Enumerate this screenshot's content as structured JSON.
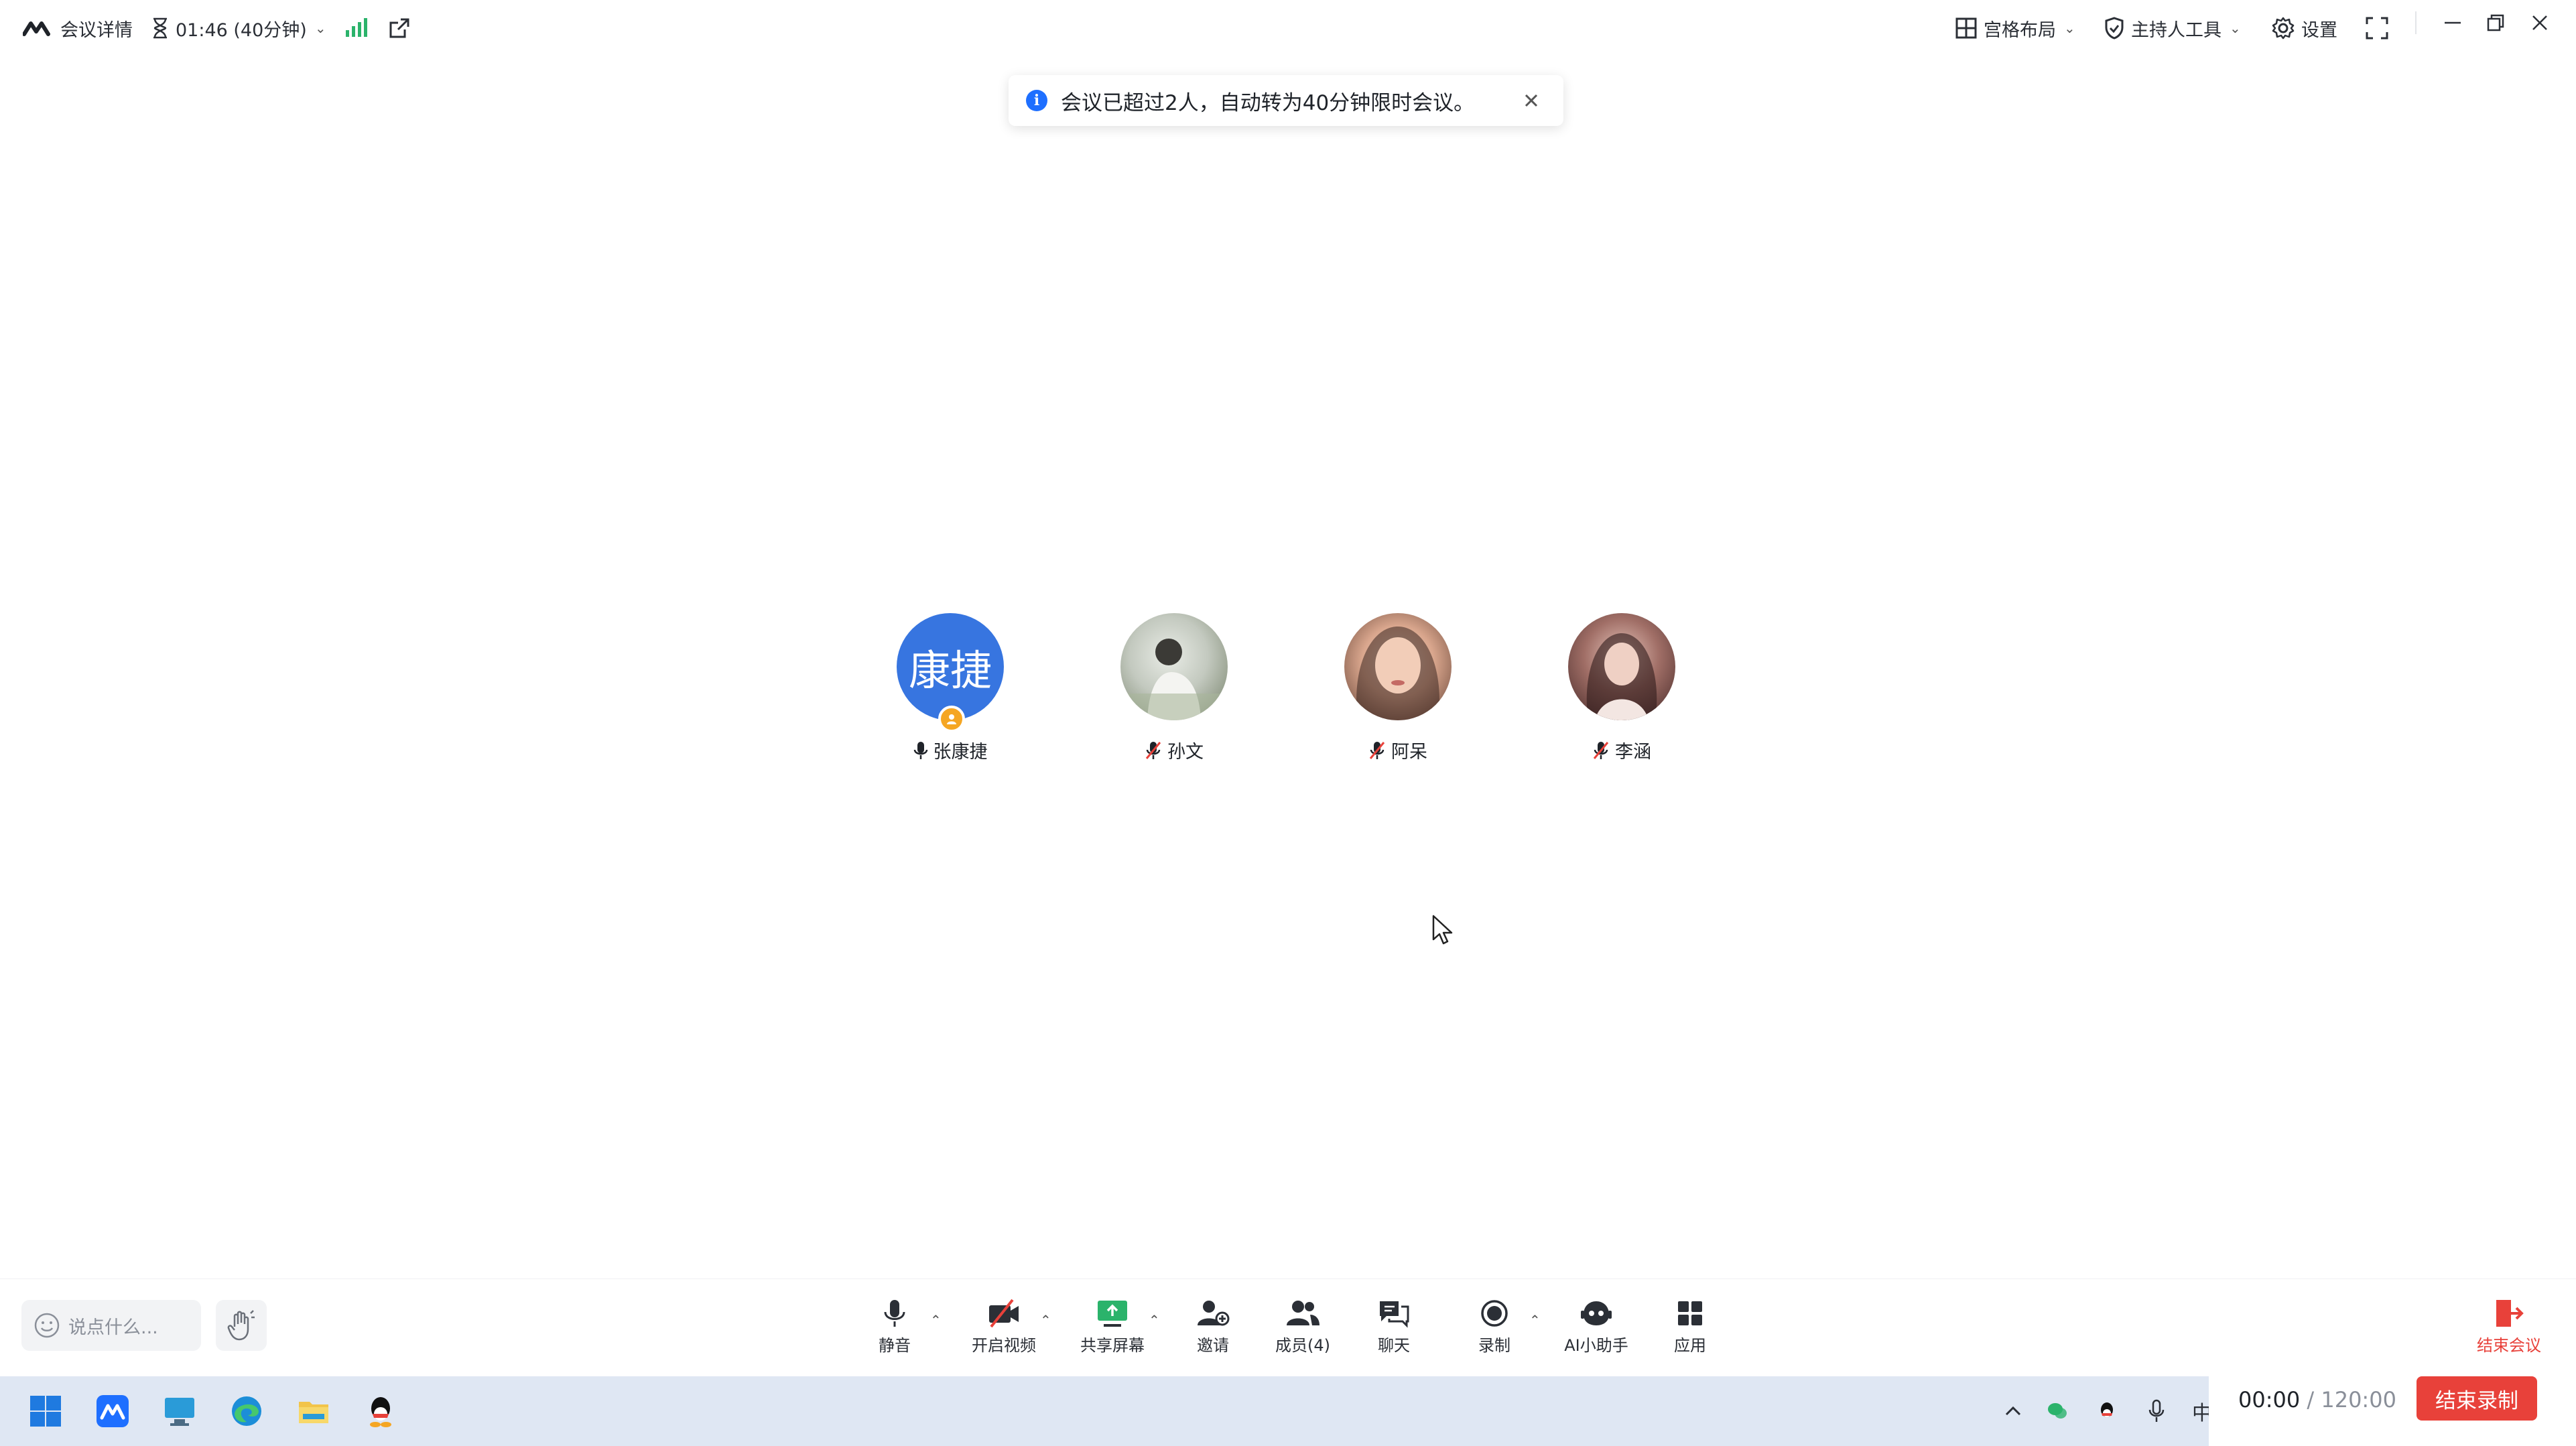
{
  "topbar": {
    "meeting_details": "会议详情",
    "timer": "01:46 (40分钟)",
    "grid_layout": "宫格布局",
    "host_tools": "主持人工具",
    "settings": "设置"
  },
  "banner": {
    "message": "会议已超过2人，自动转为40分钟限时会议。"
  },
  "participants": [
    {
      "name": "张康捷",
      "avatar_text": "康捷",
      "avatar_color": "#3775e0",
      "mic": "on",
      "host": true
    },
    {
      "name": "孙文",
      "avatar_text": "",
      "mic": "muted"
    },
    {
      "name": "阿呆",
      "avatar_text": "",
      "mic": "muted"
    },
    {
      "name": "李涵",
      "avatar_text": "",
      "mic": "muted"
    }
  ],
  "chat": {
    "placeholder": "说点什么..."
  },
  "toolbar": {
    "mute": "静音",
    "start_video": "开启视频",
    "share_screen": "共享屏幕",
    "invite": "邀请",
    "members": "成员(4)",
    "chat": "聊天",
    "record": "录制",
    "ai_assistant": "AI小助手",
    "apps": "应用",
    "end_meeting": "结束会议"
  },
  "recording": {
    "elapsed": "00:00",
    "separator": " / ",
    "total": "120:00",
    "stop_label": "结束录制"
  },
  "taskbar": {
    "ime": "中"
  },
  "colors": {
    "accent_blue": "#1e6fff",
    "danger_red": "#e8413a",
    "signal_green": "#2bb36b"
  }
}
